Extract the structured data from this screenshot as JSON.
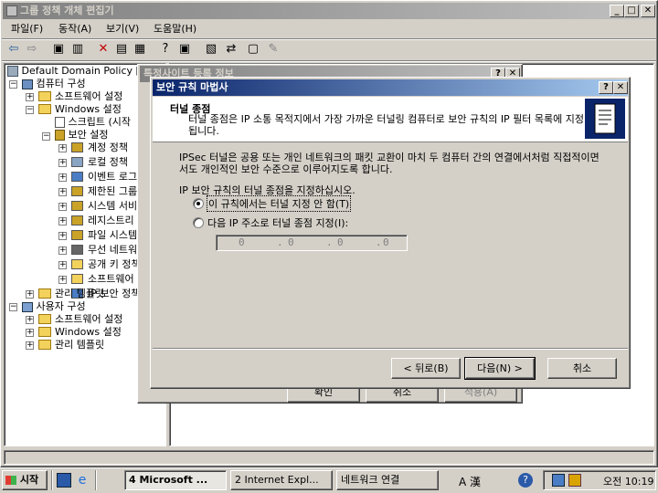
{
  "main_window": {
    "title": "그룹 정책 개체 편집기",
    "menu": [
      "파일(F)",
      "동작(A)",
      "보기(V)",
      "도움말(H)"
    ]
  },
  "tree": {
    "root": "Default Domain Policy [I",
    "computer_config": "컴퓨터 구성",
    "software_settings": "소프트웨어 설정",
    "windows_settings": "Windows 설정",
    "scripts": "스크립트 (시작",
    "security_settings": "보안 설정",
    "security_children": [
      "계정 정책",
      "로컬 정책",
      "이벤트 로그",
      "제한된 그룹",
      "시스템 서비",
      "레지스트리",
      "파일 시스템",
      "무선 네트워",
      "공개 키 정책",
      "소프트웨어",
      "IP 보안 정책"
    ],
    "admin_templates": "관리 템플릿",
    "user_config": "사용자 구성",
    "user_software": "소프트웨어 설정",
    "user_windows": "Windows 설정",
    "user_admin": "관리 템플릿"
  },
  "behind_dialog": {
    "title": "특정사이트 등록 정보",
    "ok": "확인",
    "cancel": "취소",
    "apply": "적용(A)"
  },
  "wizard": {
    "title": "보안 규칙 마법사",
    "header_title": "터널 종점",
    "header_desc": "터널 종점은 IP 소통 목적지에서 가장 가까운 터널링 컴퓨터로 보안 규칙의 IP 필터 목록에 지정됩니다.",
    "body_text": "IPSec 터널은 공용 또는 개인 네트워크의 패킷 교환이 마치 두 컴퓨터 간의 연결에서처럼 직접적이면서도 개인적인 보안 수준으로 이루어지도록 합니다.",
    "prompt": "IP 보안 규칙의 터널 종점을 지정하십시오.",
    "option_no_tunnel": "이 규칙에서는 터널 지정 안 함(T)",
    "option_ip": "다음 IP 주소로 터널 종점 지정(I):",
    "ip_octets": [
      "0",
      "0",
      "0",
      "0"
    ],
    "back": "< 뒤로(B)",
    "next": "다음(N) >",
    "cancel": "취소"
  },
  "taskbar": {
    "start": "시작",
    "tasks": [
      "4 Microsoft ...",
      "2 Internet Expl...",
      "네트워크 연결"
    ],
    "ime": "A 漢",
    "clock_period": "오전",
    "clock_time": "10:19"
  },
  "colors": {
    "title_active": "#0a246a",
    "face": "#d4d0c8",
    "desktop": "#3a6ea5"
  }
}
